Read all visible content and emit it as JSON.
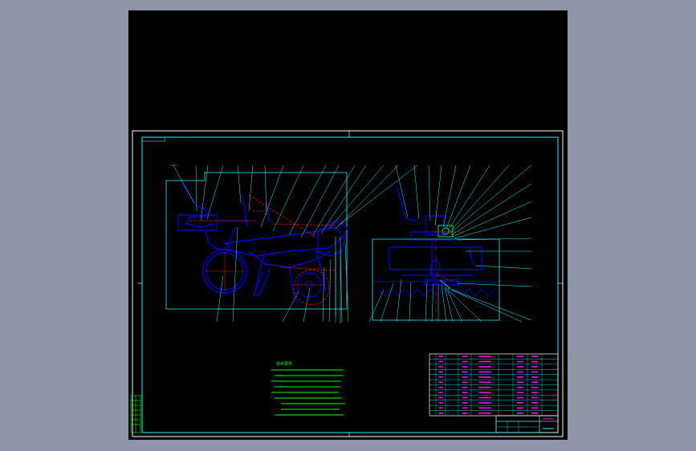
{
  "app": {
    "background_color": "#8c94a6",
    "viewport_color": "#000000"
  },
  "drawing": {
    "frame_color": "#ffffff",
    "line_color_cyan": "#00ffff",
    "line_color_blue": "#0000ff",
    "line_color_red": "#ff0000",
    "line_color_green": "#00ff00",
    "line_color_magenta": "#ff00ff",
    "frame_tag_text": "",
    "notes_title": "技术要求",
    "notes_lines": [
      "",
      "",
      "",
      "",
      "",
      "",
      "",
      "",
      ""
    ],
    "title_block": {
      "drawing_name": "",
      "drawing_number": ""
    },
    "bom_rows": 12,
    "bom_columns": 8
  }
}
